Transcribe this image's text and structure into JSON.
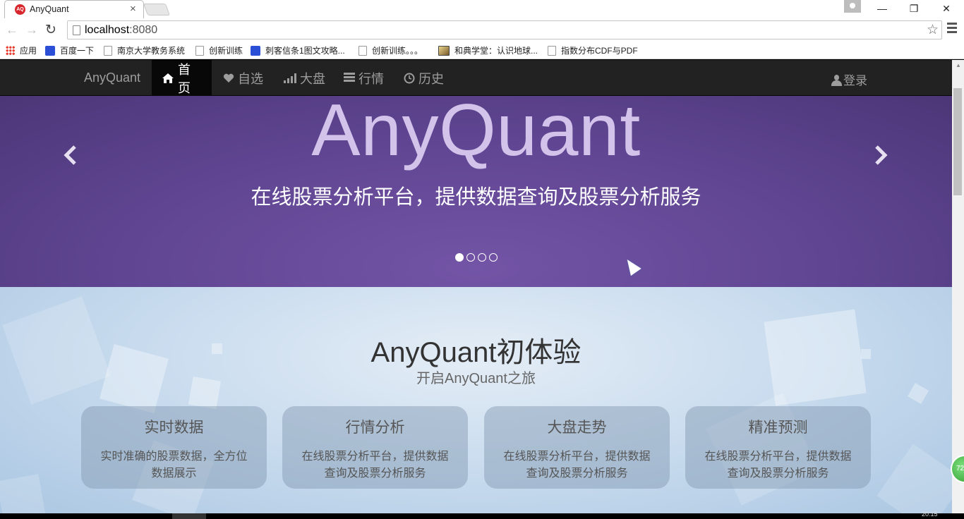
{
  "browser": {
    "tab_title": "AnyQuant",
    "tab_close": "×",
    "window_minimize": "—",
    "window_restore": "❐",
    "window_close": "✕",
    "back": "←",
    "forward": "→",
    "reload": "↻",
    "url_host": "localhost",
    "url_port": ":8080",
    "star": "☆",
    "bookmarks": [
      {
        "label": "应用",
        "icon": "apps-icon"
      },
      {
        "label": "百度一下",
        "icon": "paw-icon"
      },
      {
        "label": "南京大学教务系统",
        "icon": "page-icon"
      },
      {
        "label": "创新训练",
        "icon": "page-icon"
      },
      {
        "label": "刺客信条1图文攻略...",
        "icon": "paw-icon"
      },
      {
        "label": "创新训练。。。",
        "icon": "page-icon"
      },
      {
        "label": "和典学堂：认识地球...",
        "icon": "image-icon"
      },
      {
        "label": "指数分布CDF与PDF",
        "icon": "page-icon"
      }
    ]
  },
  "navbar": {
    "brand": "AnyQuant",
    "items": [
      {
        "label": "首页",
        "icon": "home-icon",
        "active": true
      },
      {
        "label": "自选",
        "icon": "heart-icon"
      },
      {
        "label": "大盘",
        "icon": "signal-bars-icon"
      },
      {
        "label": "行情",
        "icon": "list-icon"
      },
      {
        "label": "历史",
        "icon": "clock-icon"
      }
    ],
    "login": "登录"
  },
  "carousel": {
    "title": "AnyQuant",
    "subtitle": "在线股票分析平台，提供数据查询及股票分析服务",
    "prev": "‹",
    "next": "›",
    "slide_count": 4,
    "active_index": 0
  },
  "features": {
    "title": "AnyQuant初体验",
    "subtitle": "开启AnyQuant之旅",
    "cards": [
      {
        "title": "实时数据",
        "body": "实时准确的股票数据，全方位数据展示"
      },
      {
        "title": "行情分析",
        "body": "在线股票分析平台，提供数据查询及股票分析服务"
      },
      {
        "title": "大盘走势",
        "body": "在线股票分析平台，提供数据查询及股票分析服务"
      },
      {
        "title": "精准预测",
        "body": "在线股票分析平台，提供数据查询及股票分析服务"
      }
    ]
  },
  "widget": {
    "label": "72"
  },
  "taskbar": {
    "time": "20:15"
  },
  "colors": {
    "navbar_bg": "#222222",
    "hero_bg": "#5f4591",
    "hero_title": "#d3c2ea",
    "features_bg": "#c8dbee"
  }
}
